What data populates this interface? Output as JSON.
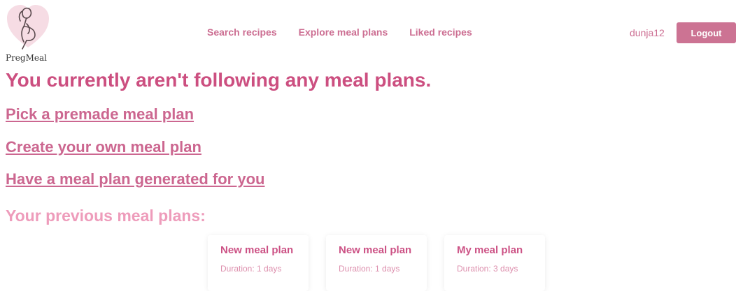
{
  "brand": {
    "name": "PregMeal",
    "logo_icon": "pregnant-woman-heart-icon",
    "heart_color": "#f6dce4"
  },
  "nav": {
    "items": [
      {
        "label": "Search recipes"
      },
      {
        "label": "Explore meal plans"
      },
      {
        "label": "Liked recipes"
      }
    ]
  },
  "user": {
    "username": "dunja12",
    "logout_label": "Logout"
  },
  "main": {
    "heading": "You currently aren't following any meal plans.",
    "links": [
      {
        "label": "Pick a premade meal plan"
      },
      {
        "label": "Create your own meal plan"
      },
      {
        "label": "Have a meal plan generated for you"
      }
    ],
    "previous_heading": "Your previous meal plans:",
    "previous_plans": [
      {
        "title": "New meal plan",
        "duration": "Duration: 1 days"
      },
      {
        "title": "New meal plan",
        "duration": "Duration: 1 days"
      },
      {
        "title": "My meal plan",
        "duration": "Duration: 3 days"
      }
    ]
  },
  "colors": {
    "accent": "#cc7393",
    "heading": "#cc4f80",
    "subheading": "#ee9cbb"
  }
}
